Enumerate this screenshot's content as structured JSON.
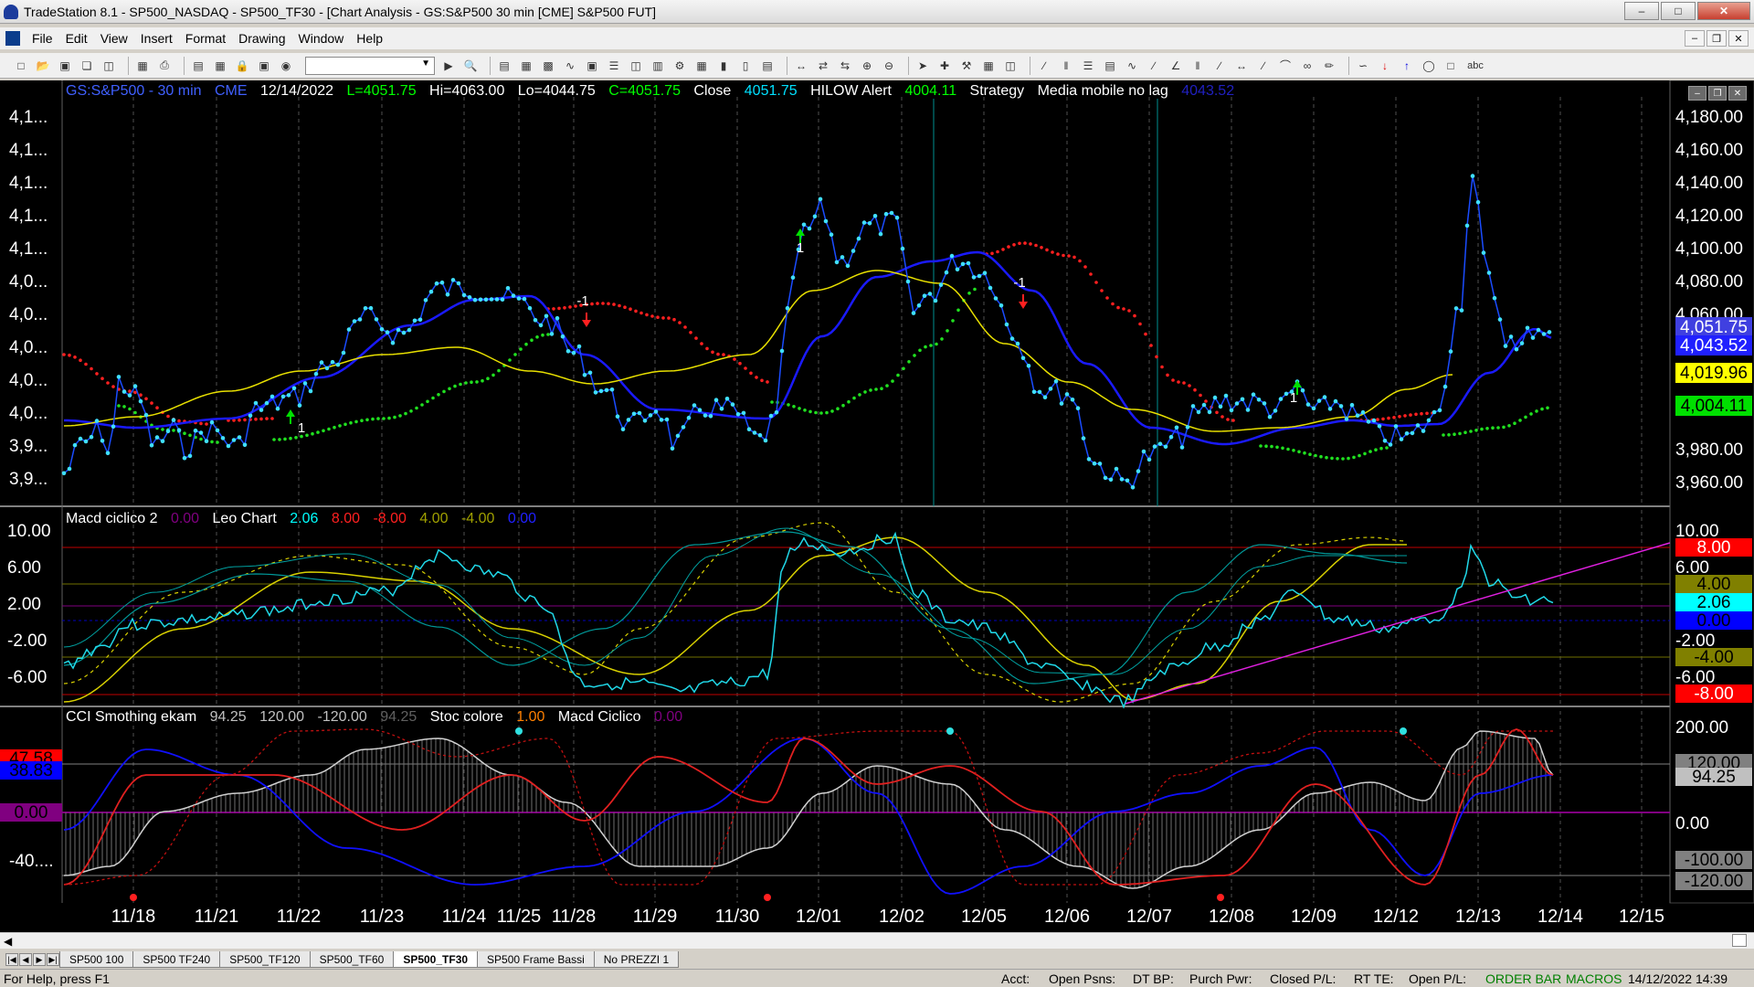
{
  "window": {
    "title": "TradeStation 8.1 - SP500_NASDAQ - SP500_TF30 - [Chart Analysis - GS:S&P500  30 min  [CME] S&P500 FUT]"
  },
  "menu": [
    "File",
    "Edit",
    "View",
    "Insert",
    "Format",
    "Drawing",
    "Window",
    "Help"
  ],
  "toolbar": {
    "combo_value": "",
    "text_tool": "abc"
  },
  "chart_header": {
    "symbol": "GS:S&P500 - 30 min",
    "exchange": "CME",
    "date": "12/14/2022",
    "last": "L=4051.75",
    "high": "Hi=4063.00",
    "low": "Lo=4044.75",
    "close": "C=4051.75",
    "close_label": "Close",
    "close_value": "4051.75",
    "hilow_label": "HILOW Alert",
    "hilow_value": "4004.11",
    "strategy_label": "Strategy",
    "media_label": "Media mobile no lag",
    "media_value": "4043.52"
  },
  "macd_header": {
    "title": "Macd ciclico 2",
    "v0": "0.00",
    "leo": "Leo Chart",
    "v1": "2.06",
    "v2": "8.00",
    "v3": "-8.00",
    "v4": "4.00",
    "v5": "-4.00",
    "v6": "0.00"
  },
  "cci_header": {
    "title": "CCI Smothing ekam",
    "v0": "94.25",
    "v1": "120.00",
    "v2": "-120.00",
    "v3": "94.25",
    "stoc": "Stoc colore",
    "v4": "1.00",
    "macd": "Macd Ciclico",
    "v5": "0.00"
  },
  "axis": {
    "price_ticks": [
      "4,180.00",
      "4,160.00",
      "4,140.00",
      "4,120.00",
      "4,100.00",
      "4,080.00",
      "4,060.00"
    ],
    "price_ticks_low": [
      "3,980.00",
      "3,960.00"
    ],
    "left_ticks": [
      "4,1...",
      "4,1...",
      "4,1...",
      "4,1...",
      "4,1...",
      "4,0...",
      "4,0...",
      "4,0...",
      "4,0...",
      "4,0...",
      "3,9...",
      "3,9..."
    ],
    "price_tags": [
      {
        "text": "4,051.75",
        "bg": "#4040e0",
        "fg": "#ffffff"
      },
      {
        "text": "4,043.52",
        "bg": "#2020ff",
        "fg": "#ffffff"
      },
      {
        "text": "4,019.96",
        "bg": "#ffff00",
        "fg": "#000000"
      },
      {
        "text": "4,004.11",
        "bg": "#00e000",
        "fg": "#000000"
      }
    ],
    "macd_ticks": [
      "10.00",
      "6.00",
      "2.00",
      "-2.00",
      "-6.00"
    ],
    "macd_tags": [
      {
        "text": "8.00",
        "bg": "#ff0000",
        "fg": "#ffffff"
      },
      {
        "text": "4.00",
        "bg": "#808000",
        "fg": "#000000"
      },
      {
        "text": "2.06",
        "bg": "#00ffff",
        "fg": "#000000"
      },
      {
        "text": "0.00",
        "bg": "#0000ff",
        "fg": "#000000"
      },
      {
        "text": "-4.00",
        "bg": "#808000",
        "fg": "#000000"
      },
      {
        "text": "-8.00",
        "bg": "#ff0000",
        "fg": "#ffffff"
      }
    ],
    "macd_left": [
      "10.00",
      "6.00",
      "2.00",
      "-2.00",
      "-6.00"
    ],
    "cci_ticks": [
      "200.00",
      "0.00"
    ],
    "cci_tags": [
      {
        "text": "120.00",
        "bg": "#808080",
        "fg": "#000000"
      },
      {
        "text": "94.25",
        "bg": "#c0c0c0",
        "fg": "#000000"
      },
      {
        "text": "-100.00",
        "bg": "#808080",
        "fg": "#000000"
      },
      {
        "text": "-120.00",
        "bg": "#808080",
        "fg": "#000000"
      }
    ],
    "cci_left": [
      {
        "text": "47.58",
        "bg": "#ff0000",
        "fg": "#000000"
      },
      {
        "text": "38.83",
        "bg": "#0000ff",
        "fg": "#000000"
      },
      {
        "text": "0.00",
        "bg": "#800080",
        "fg": "#000000"
      }
    ],
    "cci_left_text": "-40....",
    "dates": [
      "11/18",
      "11/21",
      "11/22",
      "11/23",
      "11/24",
      "11/25",
      "11/28",
      "11/29",
      "11/30",
      "12/01",
      "12/02",
      "12/05",
      "12/06",
      "12/07",
      "12/08",
      "12/09",
      "12/12",
      "12/13",
      "12/14",
      "12/15"
    ]
  },
  "signals": [
    {
      "label": "1",
      "dir": "up"
    },
    {
      "label": "-1",
      "dir": "down"
    },
    {
      "label": "1",
      "dir": "up"
    },
    {
      "label": "-1",
      "dir": "down"
    },
    {
      "label": "1",
      "dir": "up"
    }
  ],
  "tabs": [
    "SP500 100",
    "SP500 TF240",
    "SP500_TF120",
    "SP500_TF60",
    "SP500_TF30",
    "SP500 Frame Bassi",
    "No PREZZI 1"
  ],
  "active_tab": "SP500_TF30",
  "status": {
    "help": "For Help, press F1",
    "acct": "Acct:",
    "open_psns": "Open Psns:",
    "dt_bp": "DT BP:",
    "purch_pwr": "Purch Pwr:",
    "closed_pl": "Closed P/L:",
    "rt_te": "RT TE:",
    "open_pl": "Open P/L:",
    "order_bar": "ORDER BAR",
    "macros": "MACROS",
    "datetime": "14/12/2022 14:39"
  },
  "colors": {
    "price_dots": "#40e0ff",
    "price_line": "#1a4cff",
    "ma_blue": "#1a1aff",
    "ma_yellow": "#e8e000",
    "dots_red": "#ff2020",
    "dots_green": "#20e020",
    "purple": "#b000b0",
    "cyan_line": "#00c8c8"
  }
}
